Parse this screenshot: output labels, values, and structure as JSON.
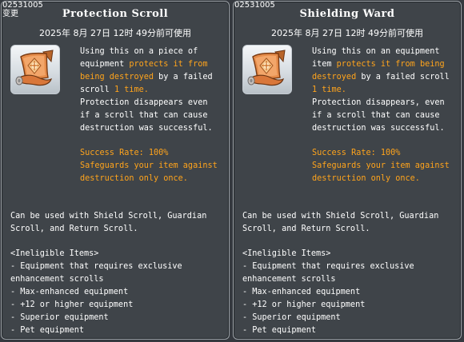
{
  "cards": [
    {
      "item_id": "02531005",
      "sub_label": "变更",
      "title": "Protection Scroll",
      "expiry": "2025年 8月 27日 12时 49分前可使用",
      "icon": "protection-scroll-icon",
      "desc": {
        "l1": "Using this on a piece of",
        "l2a": "equipment ",
        "l2b": "protects it from",
        "l3a": "being destroyed",
        "l3b": " by a failed",
        "l4a": "scroll ",
        "l4b": "1 time.",
        "l5": "Protection disappears even",
        "l6": "if a scroll that can cause",
        "l7": "destruction was successful."
      },
      "success": {
        "l1": "Success Rate: 100%",
        "l2": "Safeguards your item against",
        "l3": "destruction only once."
      },
      "usage": {
        "l1": "Can be used with Shield Scroll, Guardian",
        "l2": "Scroll, and Return Scroll."
      },
      "ineligible": {
        "header": "<Ineligible Items>",
        "items": [
          "- Equipment that requires exclusive",
          "enhancement scrolls",
          "- Max-enhanced equipment",
          "- +12 or higher equipment",
          "- Superior equipment",
          "- Pet equipment"
        ]
      }
    },
    {
      "item_id": "02531005",
      "title": "Shielding Ward",
      "expiry": "2025年 8月 27日 12时 49分前可使用",
      "icon": "protection-scroll-icon",
      "desc": {
        "l1": "Using this on an equipment",
        "l2a": "item ",
        "l2b": "protects it from being",
        "l3a": "destroyed",
        "l3b": " by a failed scroll",
        "l4a": "",
        "l4b": "1 time.",
        "l5": "Protection disappears, even",
        "l6": "if a scroll that can cause",
        "l7": "destruction was successful."
      },
      "success": {
        "l1": "Success Rate: 100%",
        "l2": "Safeguards your item against",
        "l3": "destruction only once."
      },
      "usage": {
        "l1": "Can be used with Shield Scroll, Guardian",
        "l2": "Scroll, and Return Scroll."
      },
      "ineligible": {
        "header": "<Ineligible Items>",
        "items": [
          "- Equipment that requires exclusive",
          "enhancement scrolls",
          "- Max-enhanced equipment",
          "- +12 or higher equipment",
          "- Superior equipment",
          "- Pet equipment"
        ]
      }
    }
  ],
  "colors": {
    "highlight": "#ffa41c",
    "panel": "#3f4449",
    "border": "#9da3a8"
  }
}
